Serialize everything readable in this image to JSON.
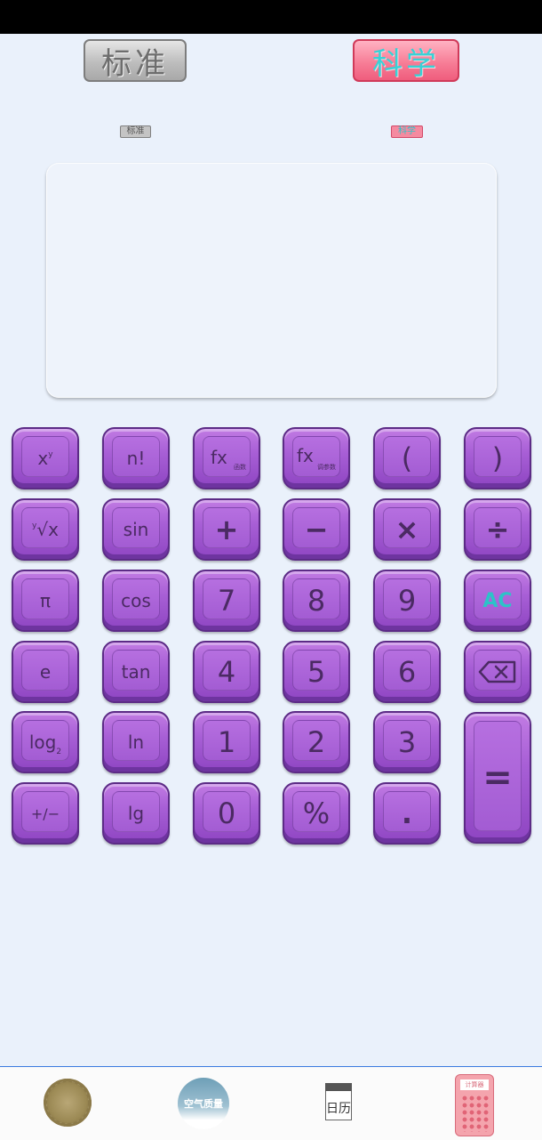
{
  "tabs": {
    "standard": "标准",
    "scientific": "科学"
  },
  "display": {
    "value": ""
  },
  "keys": {
    "xpow": "x",
    "xpow_sup": "y",
    "fact": "n!",
    "fx_func": "fx",
    "fx_func_sub": "函数",
    "fx_param": "fx",
    "fx_param_sub": "调参数",
    "lparen": "(",
    "rparen": ")",
    "root": "x",
    "root_sup": "y",
    "sin": "sin",
    "plus": "+",
    "minus": "−",
    "times": "×",
    "divide": "÷",
    "pi": "π",
    "cos": "cos",
    "seven": "7",
    "eight": "8",
    "nine": "9",
    "ac": "AC",
    "e": "e",
    "tan": "tan",
    "four": "4",
    "five": "5",
    "six": "6",
    "log": "log",
    "log_sub": "2",
    "ln": "ln",
    "one": "1",
    "two": "2",
    "three": "3",
    "equals": "=",
    "plusminus": "+/−",
    "lg": "lg",
    "zero": "0",
    "percent": "%",
    "dot": "."
  },
  "nav": {
    "air_label": "空气质量",
    "calendar_label": "日历",
    "calc_label": "计算器"
  },
  "colors": {
    "key_purple": "#a85fd6",
    "ac_teal": "#2cc3c8",
    "scientific_tab": "#f77e97",
    "background": "#eaf1fb"
  }
}
